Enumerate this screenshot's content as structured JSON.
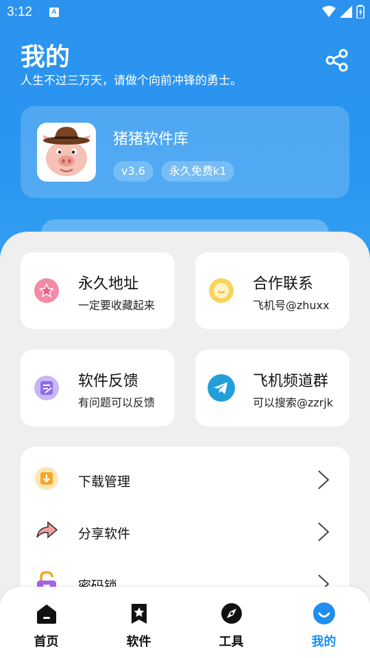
{
  "status_bar": {
    "time": "3:12",
    "notification_glyph": "A"
  },
  "header": {
    "title": "我的",
    "subtitle": "人生不过三万天，请做个向前冲锋的勇士。",
    "share_icon": "share-icon"
  },
  "app_card": {
    "name": "猪猪软件库",
    "version": "v3.6",
    "license": "永久免费k1",
    "logo_icon": "pig-logo"
  },
  "grid": [
    {
      "title": "永久地址",
      "sub": "一定要收藏起来",
      "icon": "star-icon",
      "color": "#f26a8d"
    },
    {
      "title": "合作联系",
      "sub": "飞机号@zhuxx",
      "icon": "chat-icon",
      "color": "#f7c540"
    },
    {
      "title": "软件反馈",
      "sub": "有问题可以反馈",
      "icon": "feedback-icon",
      "color": "#a78bf0"
    },
    {
      "title": "飞机频道群",
      "sub": "可以搜索@zzrjk",
      "icon": "telegram-icon",
      "color": "#229ed9"
    }
  ],
  "list": [
    {
      "label": "下载管理",
      "icon": "download-icon",
      "color": "#f5a623"
    },
    {
      "label": "分享软件",
      "icon": "share-arrow-icon",
      "color": "#f08a8a"
    },
    {
      "label": "密码锁",
      "icon": "lock-icon",
      "color": "#a463e8"
    }
  ],
  "tabs": [
    {
      "label": "首页",
      "icon": "home-icon",
      "active": false
    },
    {
      "label": "软件",
      "icon": "bookmark-star-icon",
      "active": false
    },
    {
      "label": "工具",
      "icon": "compass-icon",
      "active": false
    },
    {
      "label": "我的",
      "icon": "profile-icon",
      "active": true
    }
  ],
  "colors": {
    "primary": "#2b93ef",
    "active_tab": "#1e8ef0",
    "background": "#efefef"
  }
}
